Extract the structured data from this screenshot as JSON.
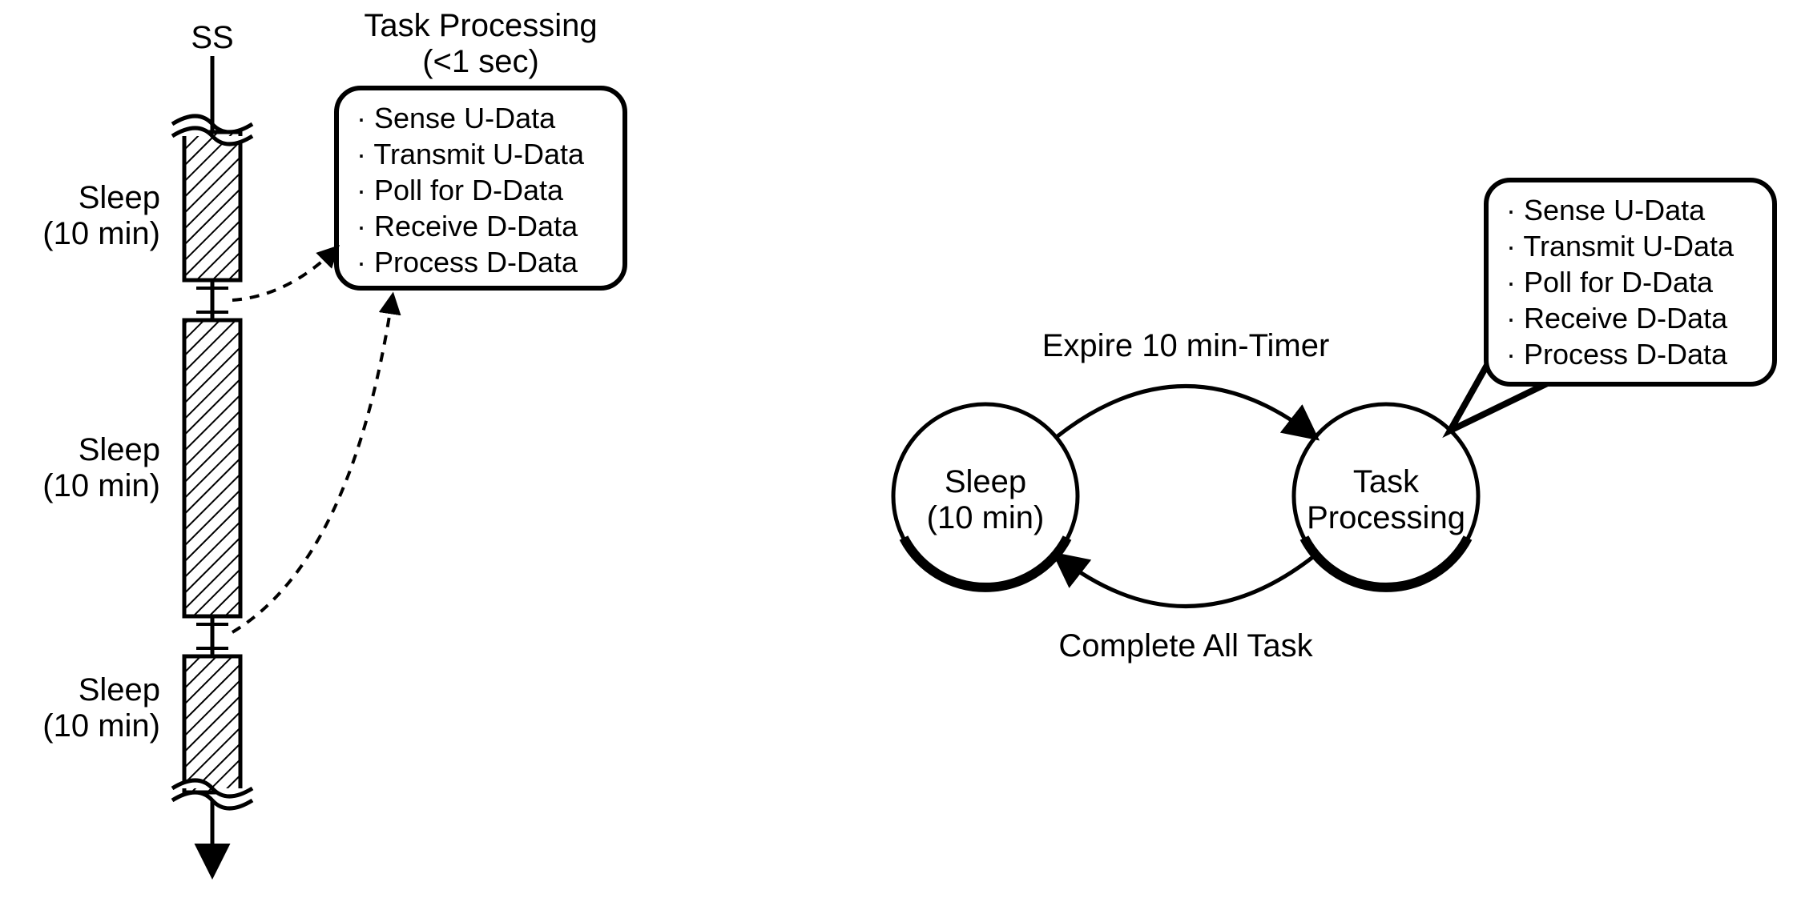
{
  "timeline": {
    "header_label": "SS",
    "sleep_label_line1": "Sleep",
    "sleep_label_line2": "(10 min)"
  },
  "task_box": {
    "title_line1": "Task Processing",
    "title_line2": "(<1 sec)",
    "items": [
      "Sense U-Data",
      "Transmit U-Data",
      "Poll for D-Data",
      "Receive D-Data",
      "Process D-Data"
    ]
  },
  "state_diagram": {
    "sleep_node_line1": "Sleep",
    "sleep_node_line2": "(10 min)",
    "task_node_line1": "Task",
    "task_node_line2": "Processing",
    "top_arc_label": "Expire 10 min-Timer",
    "bottom_arc_label": "Complete All Task",
    "callout_items": [
      "Sense U-Data",
      "Transmit U-Data",
      "Poll for D-Data",
      "Receive D-Data",
      "Process D-Data"
    ]
  }
}
